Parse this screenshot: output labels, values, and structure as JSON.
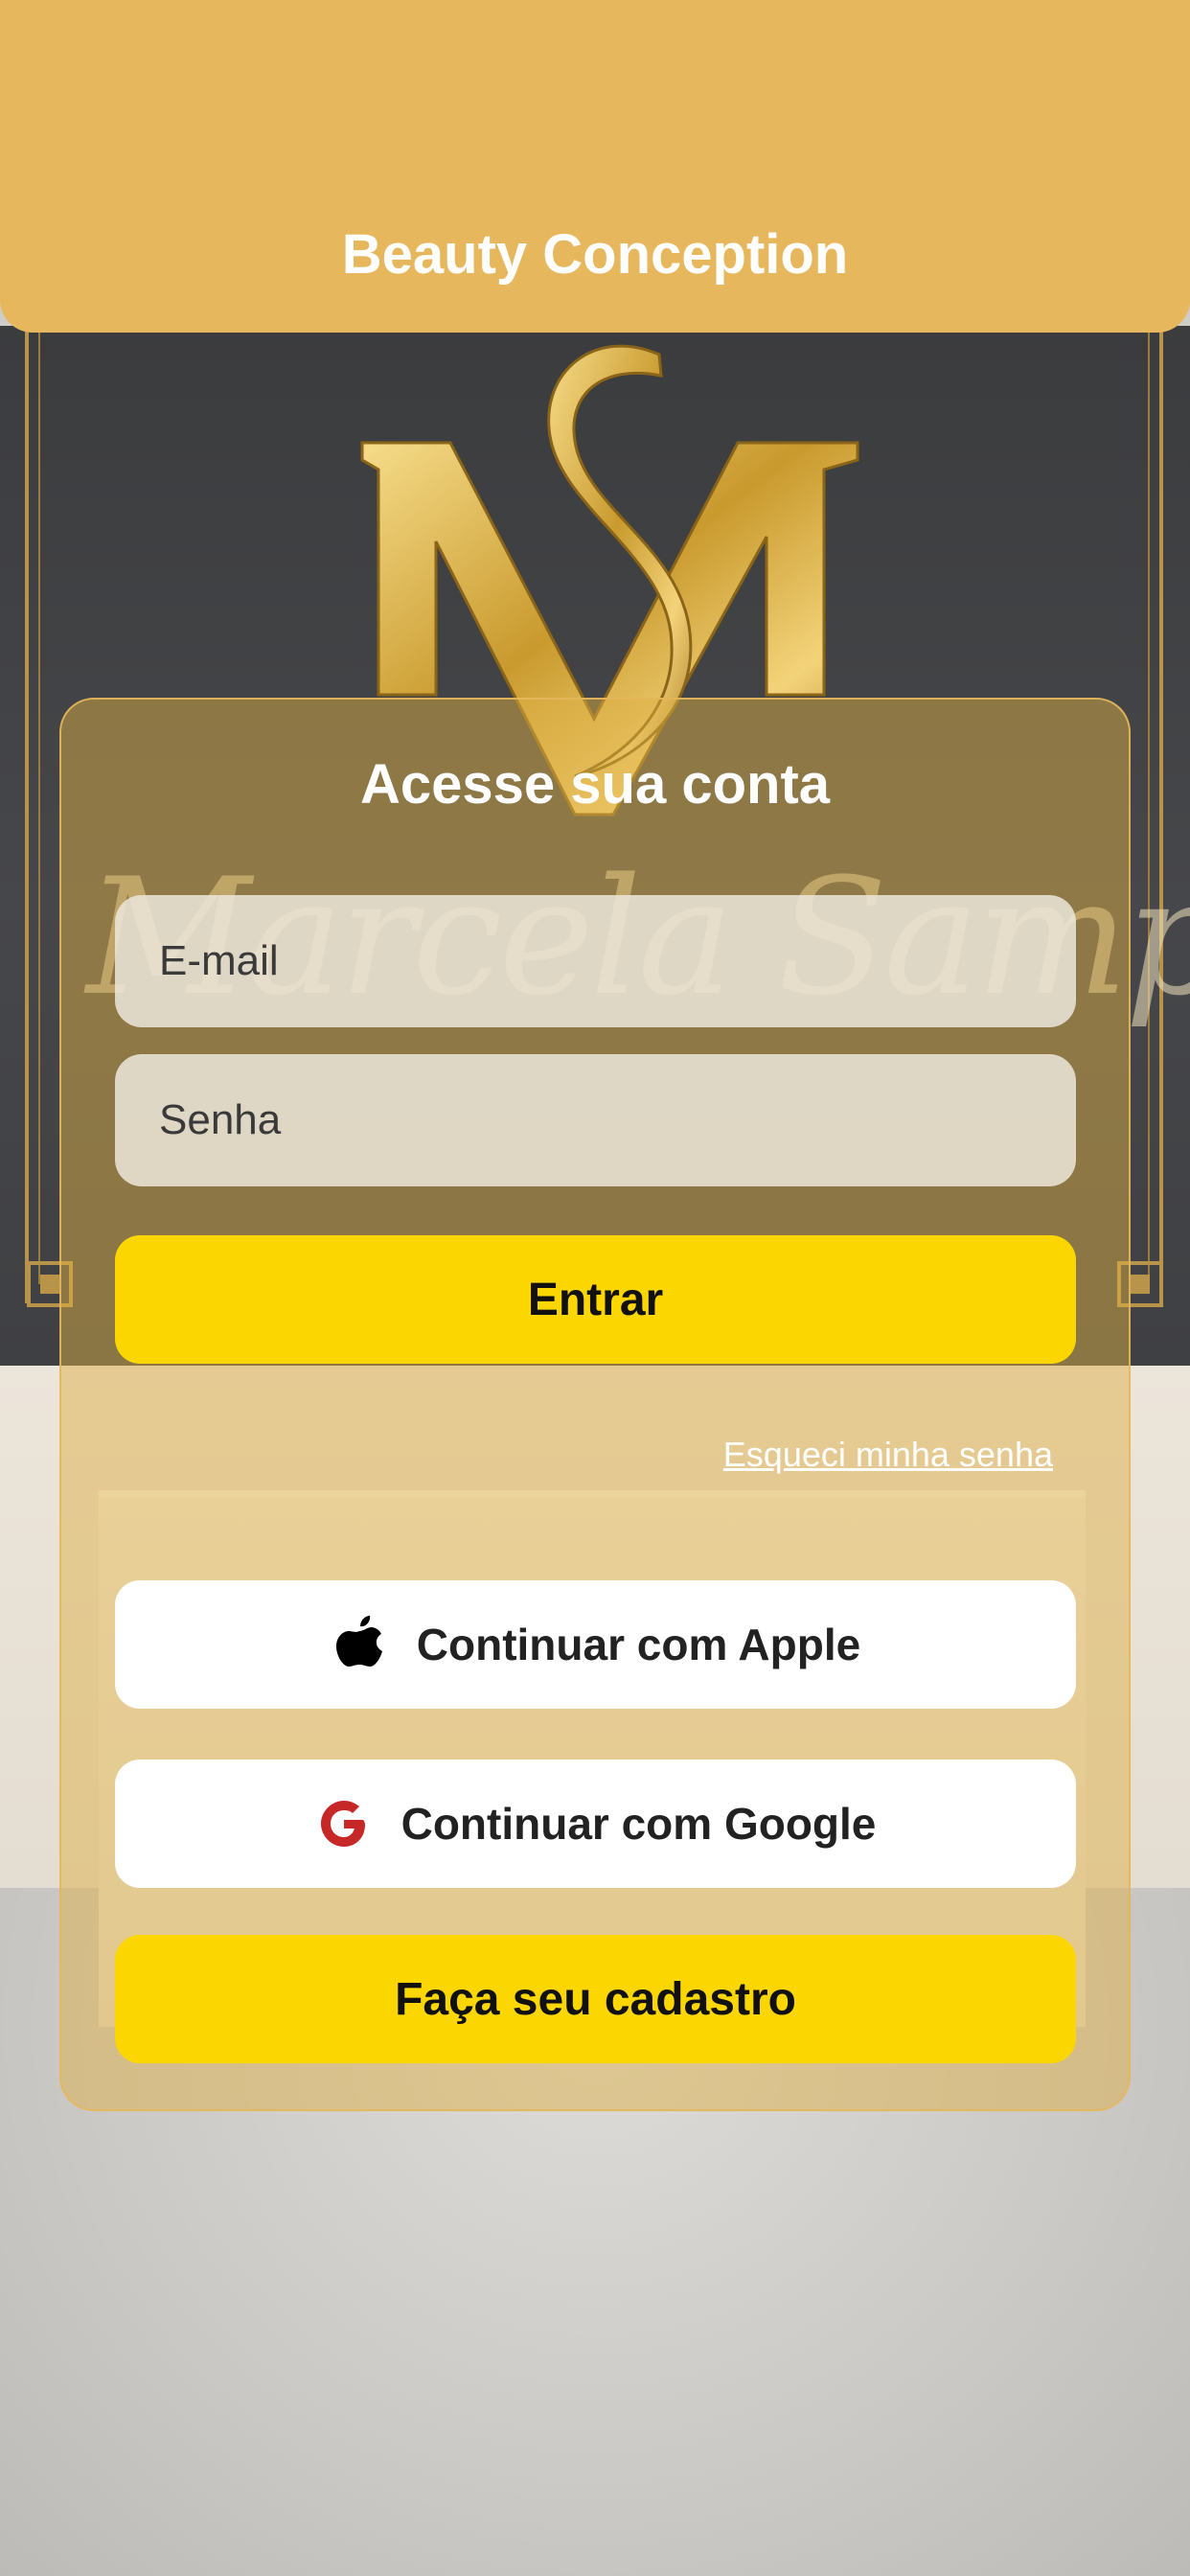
{
  "header": {
    "title": "Beauty Conception"
  },
  "background": {
    "script_text": "Marcela Sampaio",
    "monogram": "MS"
  },
  "login": {
    "title": "Acesse sua conta",
    "email_placeholder": "E-mail",
    "password_placeholder": "Senha",
    "submit_label": "Entrar",
    "forgot_password_label": "Esqueci minha senha",
    "apple_label": "Continuar com Apple",
    "google_label": "Continuar com Google",
    "register_label": "Faça seu cadastro"
  },
  "icons": {
    "apple": "apple-icon",
    "google": "google-icon"
  },
  "colors": {
    "header": "#e6b75c",
    "primary_button": "#fcd600",
    "card_tint": "#deb046",
    "google_red": "#c62828"
  }
}
